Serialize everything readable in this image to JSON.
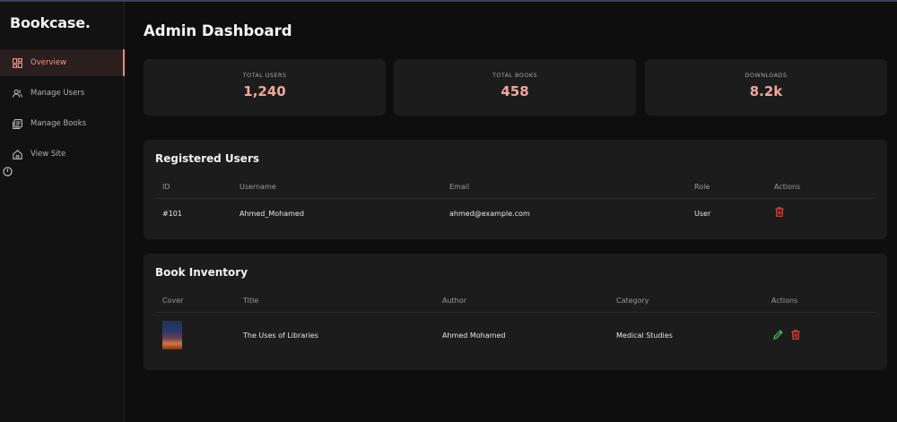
{
  "brand": "Bookcase.",
  "sidebar": {
    "items": [
      {
        "label": "Overview",
        "icon": "grid-icon",
        "active": true
      },
      {
        "label": "Manage Users",
        "icon": "users-icon",
        "active": false
      },
      {
        "label": "Manage Books",
        "icon": "book-icon",
        "active": false
      },
      {
        "label": "View Site",
        "icon": "home-icon",
        "active": false
      }
    ]
  },
  "page": {
    "title": "Admin Dashboard"
  },
  "stats": [
    {
      "label": "Total Users",
      "value": "1,240"
    },
    {
      "label": "Total Books",
      "value": "458"
    },
    {
      "label": "Downloads",
      "value": "8.2k"
    }
  ],
  "users_panel": {
    "title": "Registered Users",
    "columns": [
      "ID",
      "Username",
      "Email",
      "Role",
      "Actions"
    ],
    "rows": [
      {
        "id": "#101",
        "username": "Ahmed_Mohamed",
        "email": "ahmed@example.com",
        "role": "User"
      }
    ]
  },
  "books_panel": {
    "title": "Book Inventory",
    "columns": [
      "Cover",
      "Title",
      "Author",
      "Category",
      "Actions"
    ],
    "rows": [
      {
        "title": "The Uses of Libraries",
        "author": "Ahmed Mohamed",
        "category": "Medical Studies"
      }
    ]
  },
  "colors": {
    "accent": "#f1a79c",
    "delete": "#e0453e",
    "edit": "#3dbb5c",
    "panel": "#1c1c1c"
  }
}
